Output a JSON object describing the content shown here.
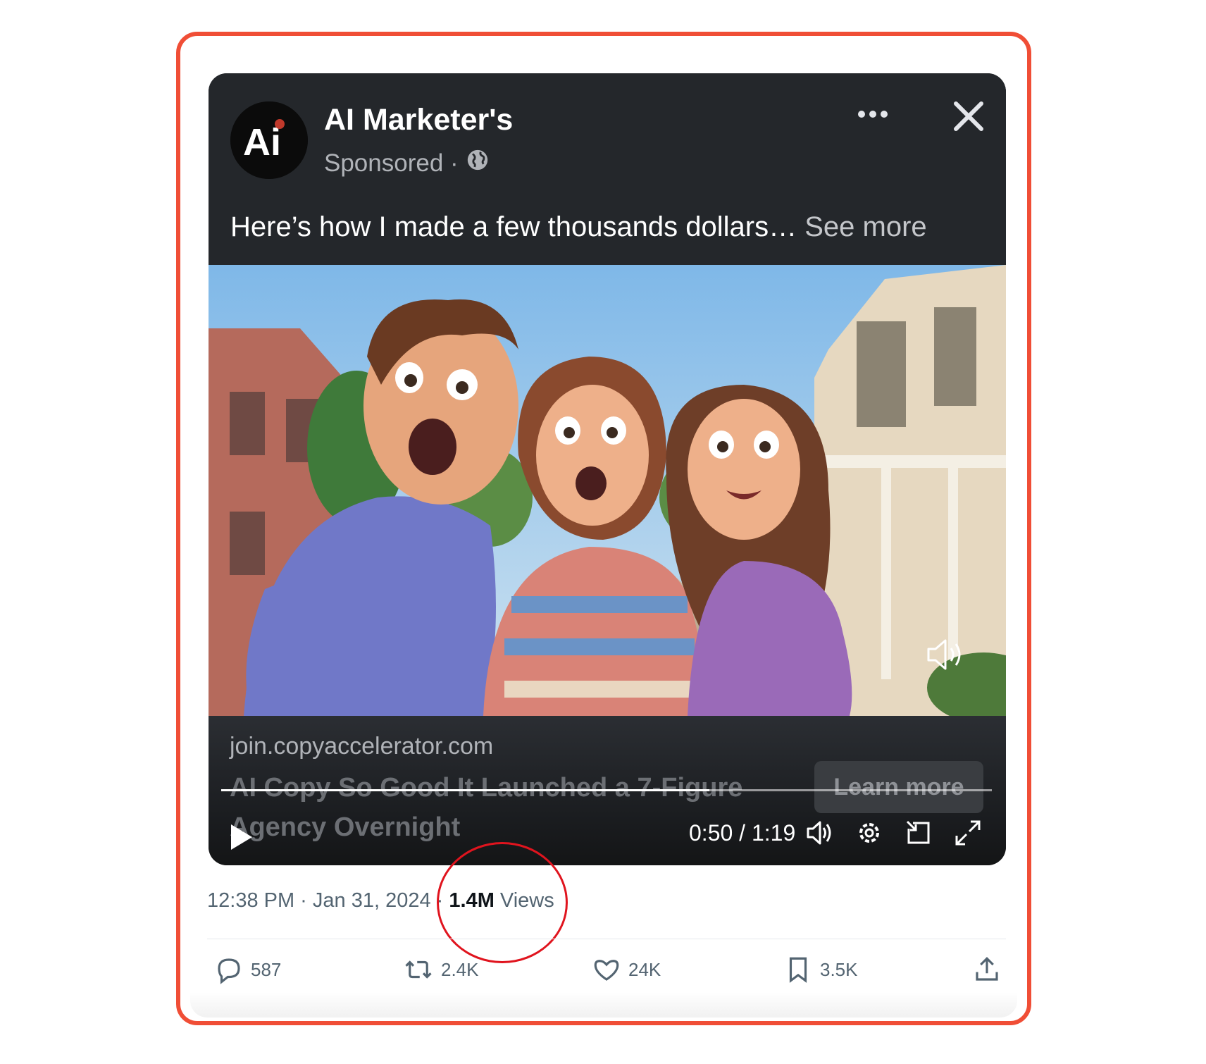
{
  "ad": {
    "advertiser": "AI Marketer's",
    "sponsored": "Sponsored ·",
    "caption": "Here’s how I made a few thousands dollars…",
    "see_more": "See more",
    "avatar_text": "Ai",
    "link_domain": "join.copyaccelerator.com",
    "headline": "AI Copy So Good It Launched a 7-Figure Agency Overnight",
    "cta": "Learn more"
  },
  "player": {
    "time": "0:50 / 1:19",
    "progress": 0.633
  },
  "tweet": {
    "time": "12:38 PM · Jan 31, 2024 ·",
    "views_count": "1.4M",
    "views_label": "Views",
    "replies": "587",
    "reposts": "2.4K",
    "likes": "24K",
    "bookmarks": "3.5K"
  },
  "colors": {
    "frame": "#f04e36",
    "highlight_circle": "#e0141e",
    "card_bg": "#24272b"
  }
}
